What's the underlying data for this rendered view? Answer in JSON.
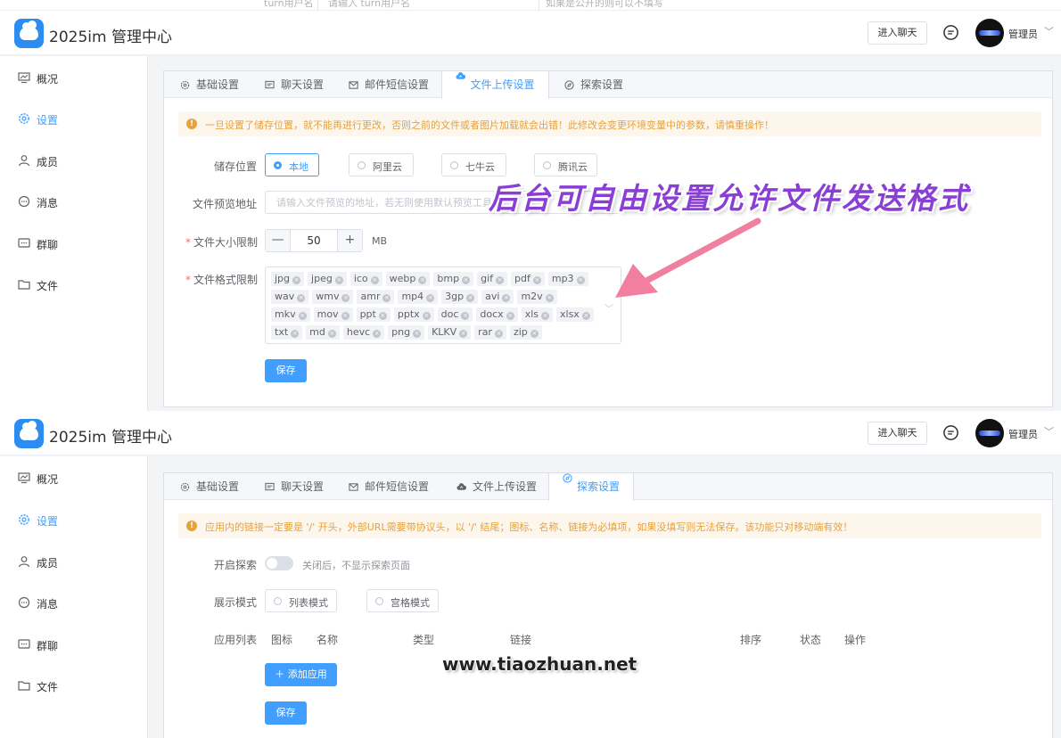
{
  "brand": {
    "title": "2025im 管理中心"
  },
  "header": {
    "enter_chat": "进入聊天",
    "user_name": "管理员",
    "user_caret": "﹀"
  },
  "sidebar": {
    "items": [
      {
        "label": "概况",
        "icon": "monitor-icon"
      },
      {
        "label": "设置",
        "icon": "gear-icon",
        "active": true
      },
      {
        "label": "成员",
        "icon": "user-icon"
      },
      {
        "label": "消息",
        "icon": "chat-bubble-icon"
      },
      {
        "label": "群聊",
        "icon": "group-chat-icon"
      },
      {
        "label": "文件",
        "icon": "folder-icon"
      }
    ]
  },
  "tabs": [
    {
      "label": "基础设置",
      "icon": "gear-icon"
    },
    {
      "label": "聊天设置",
      "icon": "chat-icon"
    },
    {
      "label": "邮件短信设置",
      "icon": "mail-icon"
    },
    {
      "label": "文件上传设置",
      "icon": "cloud-upload-icon"
    },
    {
      "label": "探索设置",
      "icon": "compass-icon"
    }
  ],
  "top_cut": {
    "col1": "turn用户名",
    "col2": "请输入 turn用户名",
    "col3": "如果是公开的则可以不填写"
  },
  "upload": {
    "alert": "一旦设置了储存位置，就不能再进行更改，否则之前的文件或者图片加载就会出错！此修改会变更环境变量中的参数，请慎重操作！",
    "storage_label": "储存位置",
    "storage_options": [
      "本地",
      "阿里云",
      "七牛云",
      "腾讯云"
    ],
    "preview_label": "文件预览地址",
    "preview_placeholder": "请输入文件预览的地址，若无则使用默认预览工具",
    "size_label": "文件大小限制",
    "size_value": "50",
    "size_unit": "MB",
    "minus": "—",
    "plus": "+",
    "format_label": "文件格式限制",
    "formats": [
      "jpg",
      "jpeg",
      "ico",
      "webp",
      "bmp",
      "gif",
      "pdf",
      "mp3",
      "wav",
      "wmv",
      "amr",
      "mp4",
      "3gp",
      "avi",
      "m2v",
      "mkv",
      "mov",
      "ppt",
      "pptx",
      "doc",
      "docx",
      "xls",
      "xlsx",
      "txt",
      "md",
      "hevc",
      "png",
      "KLKV",
      "rar",
      "zip"
    ],
    "tag_close": "×",
    "caret": "﹀",
    "save": "保存"
  },
  "explore": {
    "alert": "应用内的链接一定要是 '/' 开头，外部URL需要带协议头，以 '/' 结尾；图标、名称、链接为必填项，如果没填写则无法保存。该功能只对移动端有效！",
    "enable_label": "开启探索",
    "enable_hint": "关闭后，不显示探索页面",
    "mode_label": "展示模式",
    "mode_options": [
      "列表模式",
      "宫格模式"
    ],
    "list_label": "应用列表",
    "columns": [
      "图标",
      "名称",
      "类型",
      "链接",
      "排序",
      "状态",
      "操作"
    ],
    "add_app": "＋ 添加应用",
    "save": "保存"
  },
  "annotation": "后台可自由设置允许文件发送格式",
  "watermark": "www.tiaozhuan.net",
  "colors": {
    "primary": "#409eff",
    "warning": "#e6a23c",
    "warning_bg": "#fdf6ec",
    "annotation": "#8a3fd4",
    "arrow": "#f07fa0"
  }
}
